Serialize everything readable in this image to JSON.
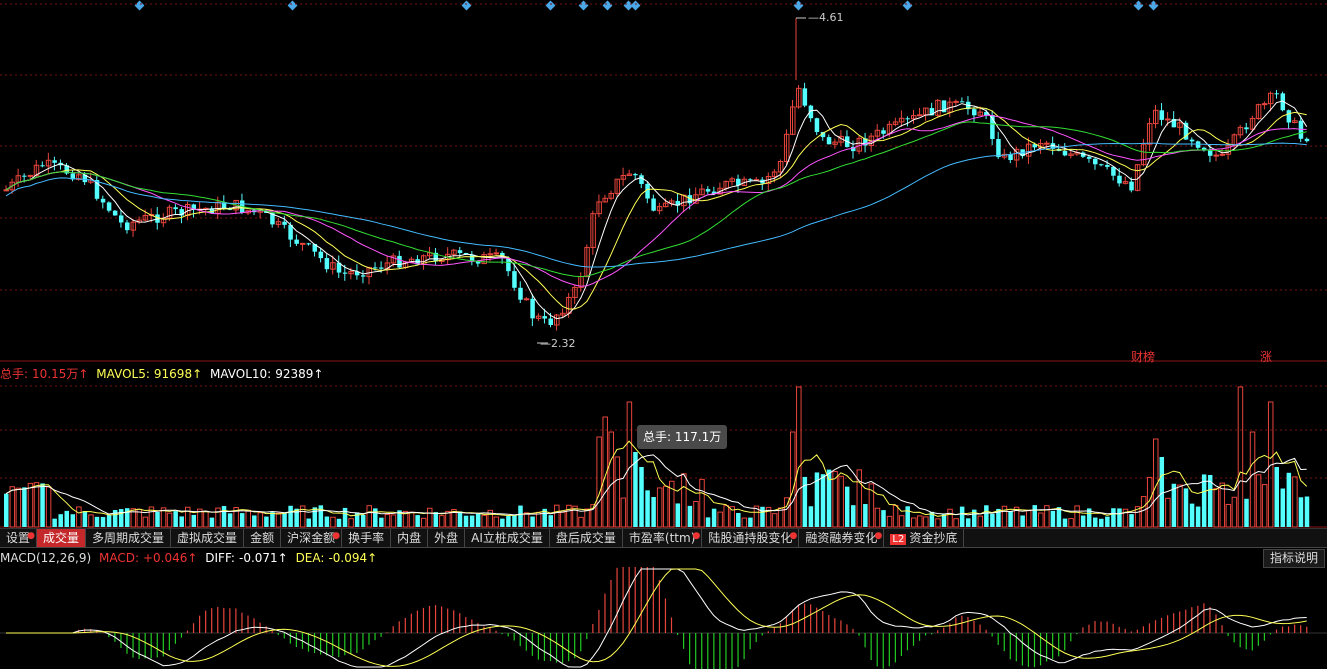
{
  "price_panel": {
    "high_label": "4.61",
    "low_label": "2.32",
    "event_tags": [
      "财榜",
      "涨"
    ]
  },
  "volume_legend": {
    "total_label": "总手:",
    "total_value": "10.15万↑",
    "mavol5_label": "MAVOL5:",
    "mavol5_value": "91698↑",
    "mavol10_label": "MAVOL10:",
    "mavol10_value": "92389↑"
  },
  "tooltip": {
    "text": "总手: 117.1万"
  },
  "tabs": [
    {
      "label": "设置",
      "dot": true
    },
    {
      "label": "成交量",
      "active": true
    },
    {
      "label": "多周期成交量"
    },
    {
      "label": "虚拟成交量"
    },
    {
      "label": "金额"
    },
    {
      "label": "沪深金额",
      "dot": true
    },
    {
      "label": "换手率"
    },
    {
      "label": "内盘"
    },
    {
      "label": "外盘"
    },
    {
      "label": "AI立桩成交量"
    },
    {
      "label": "盘后成交量"
    },
    {
      "label": "市盈率(ttm)",
      "dot": true
    },
    {
      "label": "陆股通持股变化",
      "dot": true
    },
    {
      "label": "融资融券变化",
      "dot": true
    },
    {
      "label": "资金抄底",
      "l2": "L2"
    }
  ],
  "macd_legend": {
    "name": "MACD(12,26,9)",
    "macd_label": "MACD:",
    "macd_value": "+0.046↑",
    "diff_label": "DIFF:",
    "diff_value": "-0.071↑",
    "dea_label": "DEA:",
    "dea_value": "-0.094↑"
  },
  "help_button": "指标说明",
  "colors": {
    "up": "#e8453c",
    "down": "#54ffff",
    "ma5": "#ffffff",
    "ma10": "#ffff55",
    "ma20": "#ff55ff",
    "ma30": "#33dd33",
    "ma60": "#44bbff",
    "legend_total": "#e33",
    "legend_mavol5": "#ffff55",
    "legend_mavol10": "#ffffff"
  }
}
